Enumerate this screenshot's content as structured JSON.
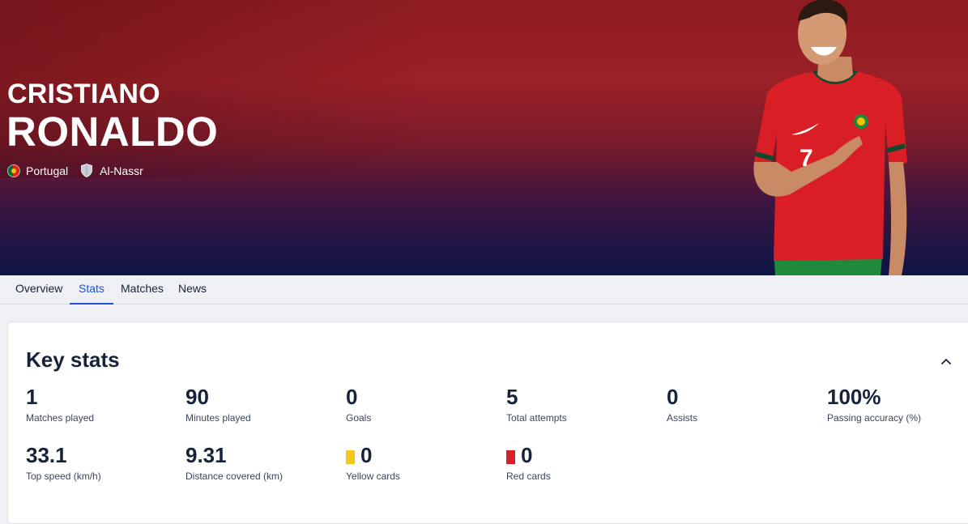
{
  "player": {
    "first_name": "CRISTIANO",
    "last_name": "RONALDO",
    "country": "Portugal",
    "club": "Al-Nassr",
    "shirt_number": "7"
  },
  "tabs": [
    {
      "label": "Overview",
      "active": false
    },
    {
      "label": "Stats",
      "active": true
    },
    {
      "label": "Matches",
      "active": false
    },
    {
      "label": "News",
      "active": false
    }
  ],
  "key_stats": {
    "title": "Key stats",
    "stats": [
      {
        "value": "1",
        "label": "Matches played"
      },
      {
        "value": "90",
        "label": "Minutes played"
      },
      {
        "value": "0",
        "label": "Goals"
      },
      {
        "value": "5",
        "label": "Total attempts"
      },
      {
        "value": "0",
        "label": "Assists"
      },
      {
        "value": "100%",
        "label": "Passing accuracy (%)"
      },
      {
        "value": "33.1",
        "label": "Top speed (km/h)"
      },
      {
        "value": "9.31",
        "label": "Distance covered (km)"
      },
      {
        "value": "0",
        "label": "Yellow cards",
        "icon": "yellow-card-icon"
      },
      {
        "value": "0",
        "label": "Red cards",
        "icon": "red-card-icon"
      }
    ]
  },
  "colors": {
    "accent": "#1e4fd6",
    "yellow_card": "#f7c51e",
    "red_card": "#d6212b"
  }
}
